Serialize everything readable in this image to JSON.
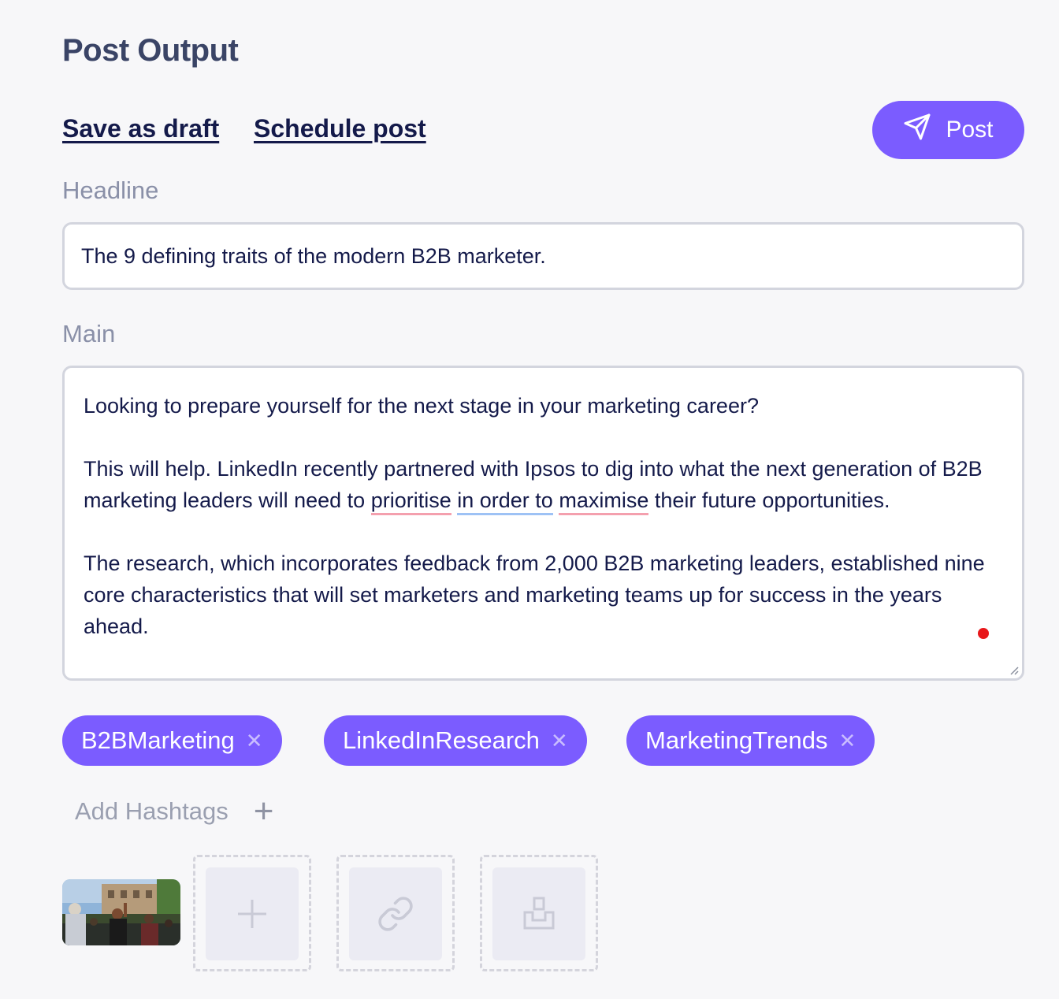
{
  "page": {
    "title": "Post Output"
  },
  "actions": {
    "save_draft": "Save as draft",
    "schedule": "Schedule post",
    "post": "Post"
  },
  "headline": {
    "label": "Headline",
    "value": "The 9 defining traits of the modern B2B marketer."
  },
  "main": {
    "label": "Main",
    "p1": "Looking to prepare yourself for the next stage in your marketing career?",
    "p2_a": "This will help. LinkedIn recently partnered with Ipsos to dig into what the next generation of B2B marketing leaders will need to ",
    "p2_w1": "prioritise",
    "p2_w2": "in order to",
    "p2_w3": "maximise",
    "p2_b": " their future opportunities.",
    "p3": "The research, which incorporates feedback from 2,000 B2B marketing leaders, established nine core characteristics that will set marketers and marketing teams up for success in the years ahead."
  },
  "hashtags": {
    "items": [
      "B2BMarketing",
      "LinkedInResearch",
      "MarketingTrends"
    ],
    "remove_glyph": "✕",
    "add_label": "Add Hashtags",
    "add_glyph": "+"
  },
  "media": {
    "slots": [
      "plus-icon",
      "link-icon",
      "inbox-icon"
    ]
  },
  "colors": {
    "accent": "#7b5cff",
    "background": "#f7f7f9",
    "text_dark": "#141a4a",
    "label_gray": "#8a90a8",
    "spell_underline": "#f4a0ae",
    "grammar_underline": "#9ec2f5"
  }
}
